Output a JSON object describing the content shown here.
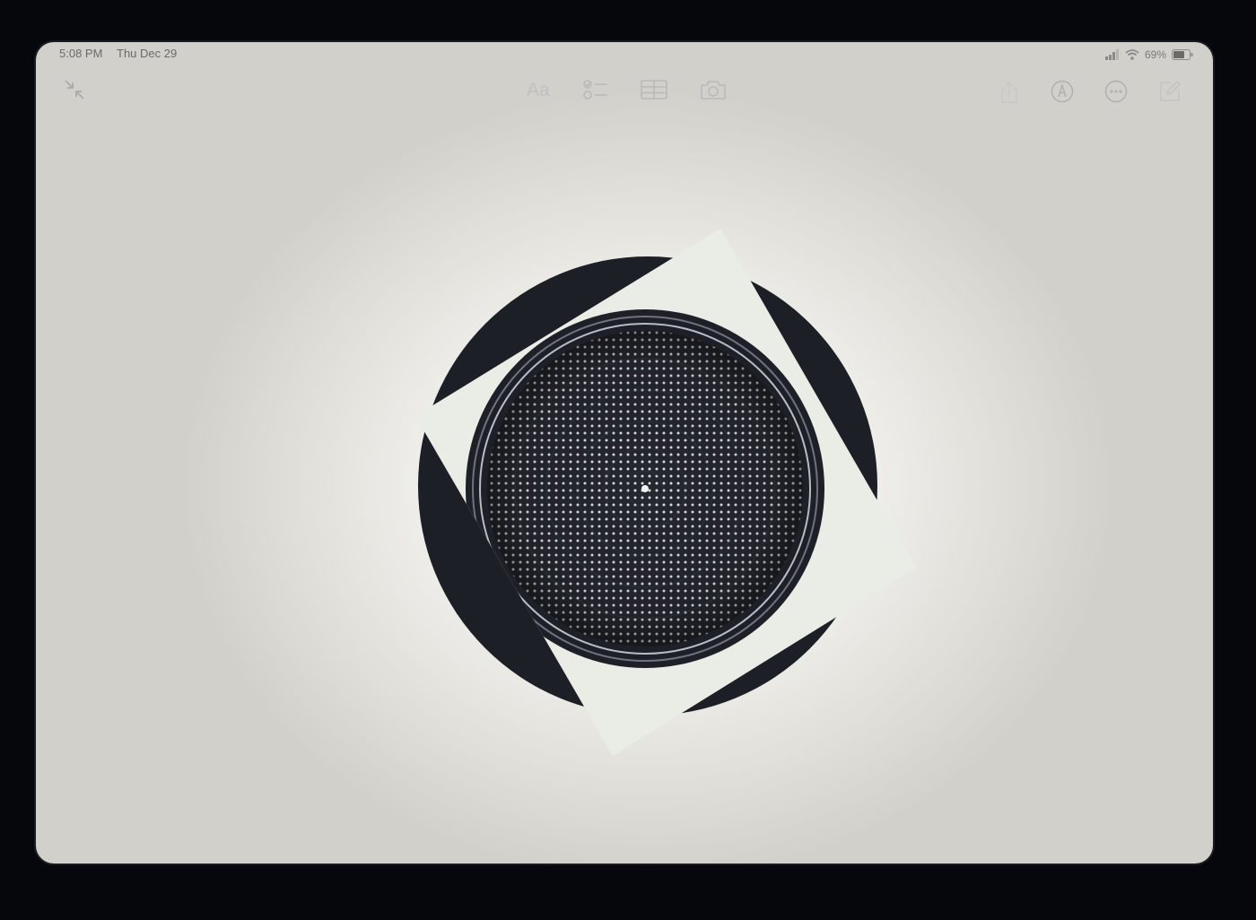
{
  "status_bar": {
    "time": "5:08 PM",
    "date": "Thu Dec 29",
    "battery": "69%",
    "icons": [
      "signal-icon",
      "wifi-icon",
      "battery-icon"
    ]
  },
  "toolbar": {
    "left": [
      "collapse-arrows-icon"
    ],
    "center": [
      "format-text-icon",
      "checklist-icon",
      "table-icon",
      "camera-icon"
    ],
    "center_text_label": "Aa",
    "right": [
      "share-icon",
      "markup-pen-icon",
      "more-options-icon",
      "compose-icon"
    ]
  },
  "note": {
    "attachment": "rotated-speaker-photo"
  },
  "colors": {
    "device_frame": "#05070c",
    "screen_background": "#eeeeea",
    "icon_gray": "#b9b9b9",
    "photo_dark": "#1c1f25",
    "photo_paper": "#eaece6"
  }
}
